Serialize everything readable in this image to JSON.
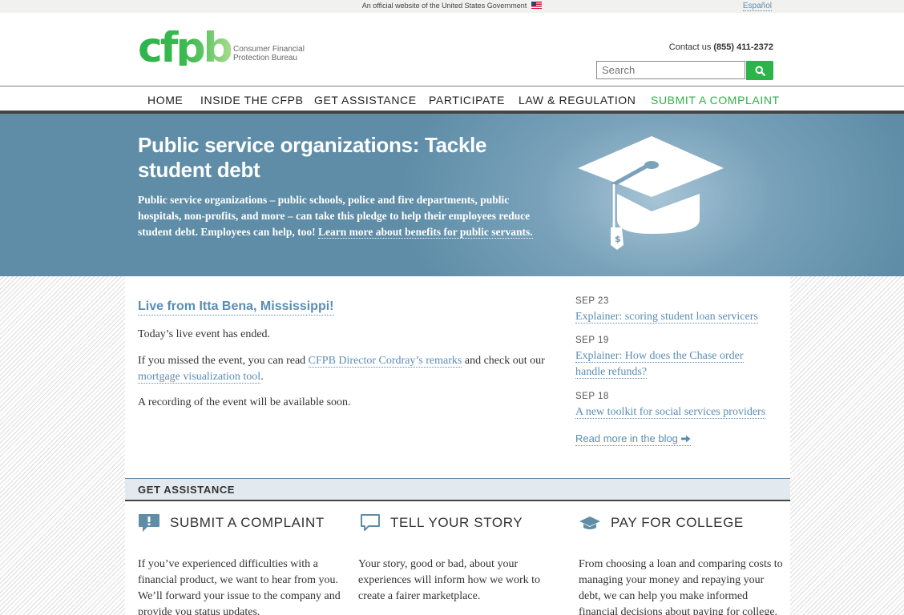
{
  "gov_banner": {
    "official_text": "An official website of the United States Government",
    "flag_icon": "us-flag-icon",
    "spanish_link": "Español"
  },
  "header": {
    "logo_text": "cfpb",
    "logo_subtitle": "Consumer Financial Protection Bureau",
    "contact_label": "Contact us",
    "contact_phone": "(855) 411-2372",
    "search_placeholder": "Search",
    "search_icon": "search-icon"
  },
  "nav": {
    "items": [
      {
        "label": "HOME"
      },
      {
        "label": "INSIDE THE CFPB"
      },
      {
        "label": "GET ASSISTANCE"
      },
      {
        "label": "PARTICIPATE"
      },
      {
        "label": "LAW & REGULATION"
      },
      {
        "label": "SUBMIT A COMPLAINT"
      }
    ]
  },
  "hero": {
    "title": "Public service organizations: Tackle student debt",
    "text": "Public service organizations – public schools, police and fire departments, public hospitals, non-profits, and more – can take this pledge to help their employees reduce student debt. Employees can help, too!",
    "link": "Learn more about benefits for public servants.",
    "icon": "graduation-cap-icon"
  },
  "event": {
    "title": "Live from Itta Bena, Mississippi!",
    "ended": "Today’s live event has ended.",
    "missed_prefix": "If you missed the event, you can read",
    "remarks_link": "CFPB Director Cordray’s remarks",
    "missed_middle": "and check out our",
    "tool_link": "mortgage visualization tool",
    "missed_suffix": ".",
    "recording": "A recording of the event will be available soon."
  },
  "blog": {
    "posts": [
      {
        "date": "SEP 23",
        "title": "Explainer: scoring student loan servicers"
      },
      {
        "date": "SEP 19",
        "title": "Explainer: How does the Chase order handle refunds?"
      },
      {
        "date": "SEP 18",
        "title": "A new toolkit for social services providers"
      }
    ],
    "read_more": "Read more in the blog",
    "arrow_icon": "arrow-right-icon"
  },
  "get_assistance": {
    "heading": "GET ASSISTANCE",
    "columns": [
      {
        "icon": "complaint-bubble-icon",
        "title": "SUBMIT A COMPLAINT",
        "text": "If you’ve experienced difficulties with a financial product, we want to hear from you. We’ll forward your issue to the company and provide you status updates."
      },
      {
        "icon": "speech-bubble-icon",
        "title": "TELL YOUR STORY",
        "text": "Your story, good or bad, about your experiences will inform how we work to create a fairer marketplace."
      },
      {
        "icon": "graduation-cap-icon",
        "title": "PAY FOR COLLEGE",
        "text": "From choosing a loan and comparing costs to managing your money and repaying your debt, we can help you make informed financial decisions about paying for college."
      }
    ]
  },
  "colors": {
    "brand_green": "#2cb34a",
    "link_blue": "#5a8db5",
    "hero_blue": "#6b97b0"
  }
}
